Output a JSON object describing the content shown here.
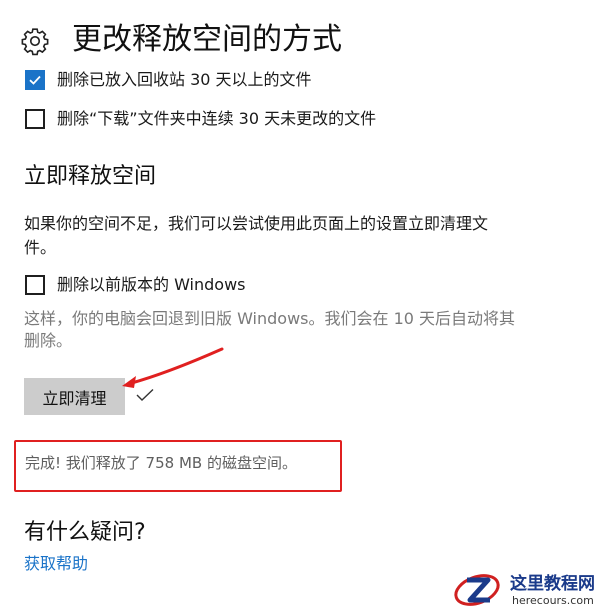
{
  "header": {
    "icon": "gear-icon",
    "title": "更改释放空间的方式"
  },
  "options": [
    {
      "label": "删除已放入回收站 30 天以上的文件",
      "checked": true
    },
    {
      "label": "删除“下载”文件夹中连续 30 天未更改的文件",
      "checked": false
    }
  ],
  "free_now": {
    "title": "立即释放空间",
    "description_line1": "如果你的空间不足，我们可以尝试使用此页面上的设置立即清理文",
    "description_line2": "件。",
    "windows_option": {
      "label": "删除以前版本的 Windows",
      "checked": false
    },
    "warning_line1": "这样，你的电脑会回退到旧版 Windows。我们会在 10 天后自动将其",
    "warning_line2": "删除。",
    "button_label": "立即清理",
    "result": "完成! 我们释放了 758 MB 的磁盘空间。"
  },
  "help": {
    "title": "有什么疑问?",
    "link": "获取帮助"
  },
  "watermark": {
    "title": "这里教程网",
    "subtitle": "herecours.com"
  },
  "colors": {
    "accent": "#1a73c8",
    "annotation_red": "#e02020",
    "button_bg": "#cccccc"
  }
}
